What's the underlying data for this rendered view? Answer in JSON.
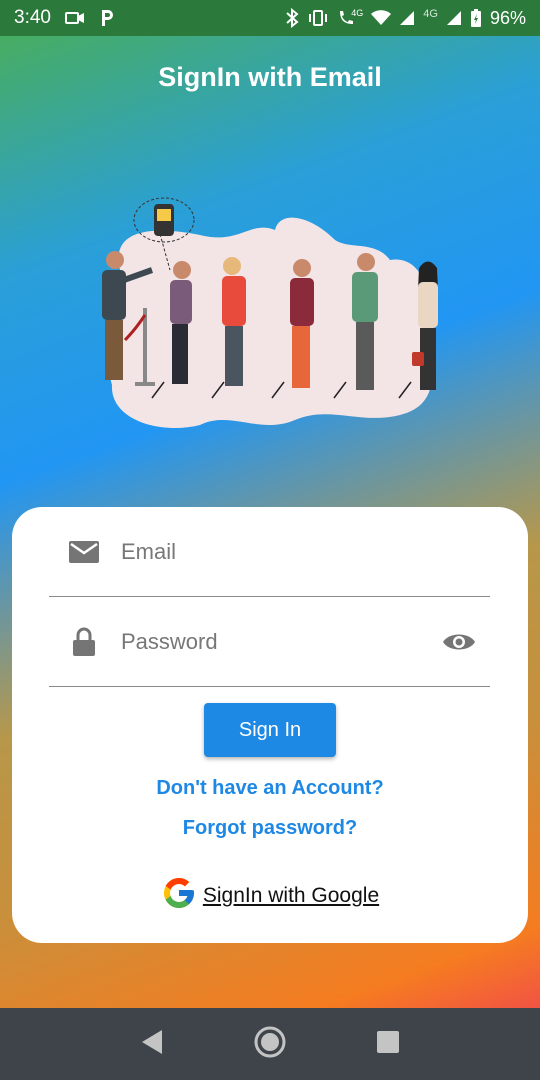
{
  "status_bar": {
    "time": "3:40",
    "network_label": "4G",
    "network_label_2": "4G",
    "battery": "96%"
  },
  "header": {
    "title": "SignIn with Email"
  },
  "form": {
    "email_placeholder": "Email",
    "password_placeholder": "Password",
    "signin_label": "Sign In",
    "no_account_link": "Don't have an Account?",
    "forgot_link": "Forgot password?",
    "google_label": "SignIn with Google"
  },
  "colors": {
    "accent": "#1e88e5",
    "status_bar": "#2b7a3b",
    "nav_bar": "#3e4449"
  },
  "icons": {
    "email": "mail-icon",
    "password": "lock-icon",
    "visibility": "eye-icon",
    "google": "google-icon"
  }
}
